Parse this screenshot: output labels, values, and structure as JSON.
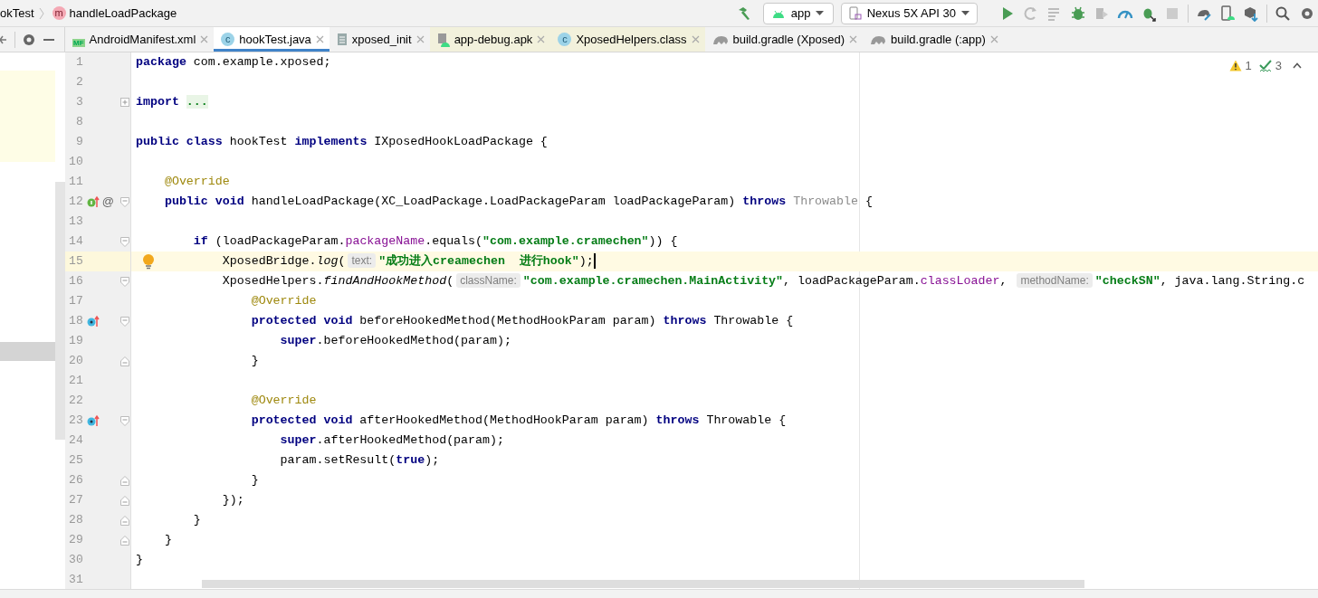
{
  "breadcrumb": [
    {
      "text": "okTest"
    },
    {
      "text": "handleLoadPackage",
      "icon_letter": "m"
    }
  ],
  "toolbar": {
    "run_config": "app",
    "device": "Nexus 5X API 30"
  },
  "tabs": [
    {
      "label": "AndroidManifest.xml",
      "kind": "manifest",
      "icon_text": "MF",
      "selected": false,
      "external": false
    },
    {
      "label": "hookTest.java",
      "kind": "java",
      "icon_text": "c",
      "selected": true,
      "external": false
    },
    {
      "label": "xposed_init",
      "kind": "text",
      "selected": false,
      "external": false
    },
    {
      "label": "app-debug.apk",
      "kind": "apk",
      "selected": false,
      "external": true
    },
    {
      "label": "XposedHelpers.class",
      "kind": "class",
      "icon_text": "c",
      "selected": false,
      "external": true
    },
    {
      "label": "build.gradle (Xposed)",
      "kind": "gradle",
      "selected": false,
      "external": false
    },
    {
      "label": "build.gradle (:app)",
      "kind": "gradle",
      "selected": false,
      "external": false
    }
  ],
  "inspections": {
    "warnings": "1",
    "typos": "3"
  },
  "lines": [
    {
      "number": "1",
      "current": false,
      "tokens": [
        {
          "kind": "k",
          "text": "package"
        },
        {
          "kind": "p",
          "text": " com.example.xposed;"
        }
      ]
    },
    {
      "number": "2",
      "current": false
    },
    {
      "number": "3",
      "current": false,
      "folded": true,
      "tokens": [
        {
          "kind": "k",
          "text": "import "
        },
        {
          "kind": "fold",
          "text": "..."
        }
      ]
    },
    {
      "number": "8",
      "current": false
    },
    {
      "number": "9",
      "current": false,
      "tokens": [
        {
          "kind": "k",
          "text": "public class"
        },
        {
          "kind": "p",
          "text": " hookTest "
        },
        {
          "kind": "k",
          "text": "implements"
        },
        {
          "kind": "p",
          "text": " IXposedHookLoadPackage {"
        }
      ]
    },
    {
      "number": "10",
      "current": false
    },
    {
      "number": "11",
      "current": false,
      "tokens": [
        {
          "kind": "a",
          "text": "    @Override"
        }
      ]
    },
    {
      "number": "12",
      "current": false,
      "implements": true,
      "marker_text": "@",
      "fold_start": true,
      "tokens": [
        {
          "kind": "k",
          "text": "    public void"
        },
        {
          "kind": "p",
          "text": " handleLoadPackage(XC_LoadPackage.LoadPackageParam loadPackageParam) "
        },
        {
          "kind": "k",
          "text": "throws"
        },
        {
          "kind": "g",
          "text": " Throwable"
        },
        {
          "kind": "p",
          "text": " {"
        }
      ]
    },
    {
      "number": "13",
      "current": false
    },
    {
      "number": "14",
      "current": false,
      "fold_start": true,
      "tokens": [
        {
          "kind": "k",
          "text": "        if"
        },
        {
          "kind": "p",
          "text": " (loadPackageParam."
        },
        {
          "kind": "f",
          "text": "packageName"
        },
        {
          "kind": "p",
          "text": ".equals("
        },
        {
          "kind": "s",
          "text": "\"com.example.cramechen\""
        },
        {
          "kind": "p",
          "text": ")) {"
        }
      ]
    },
    {
      "number": "15",
      "current": true,
      "bulb": true,
      "caret": true,
      "tokens": [
        {
          "kind": "p",
          "text": "            XposedBridge."
        },
        {
          "kind": "i",
          "text": "log"
        },
        {
          "kind": "p",
          "text": "("
        },
        {
          "kind": "h",
          "text": "text:"
        },
        {
          "kind": "s",
          "text": "\"成功进入creamechen  进行hook\""
        },
        {
          "kind": "p",
          "text": ");"
        }
      ]
    },
    {
      "number": "16",
      "current": false,
      "fold_start": true,
      "tokens": [
        {
          "kind": "p",
          "text": "            XposedHelpers."
        },
        {
          "kind": "i",
          "text": "findAndHookMethod"
        },
        {
          "kind": "p",
          "text": "("
        },
        {
          "kind": "h",
          "text": "className:"
        },
        {
          "kind": "s",
          "text": "\"com.example.cramechen.MainActivity\""
        },
        {
          "kind": "p",
          "text": ", loadPackageParam."
        },
        {
          "kind": "f",
          "text": "classLoader"
        },
        {
          "kind": "p",
          "text": ", "
        },
        {
          "kind": "h",
          "text": "methodName:"
        },
        {
          "kind": "s",
          "text": "\"checkSN\""
        },
        {
          "kind": "p",
          "text": ", java.lang.String.c"
        }
      ]
    },
    {
      "number": "17",
      "current": false,
      "tokens": [
        {
          "kind": "a",
          "text": "                @Override"
        }
      ]
    },
    {
      "number": "18",
      "current": false,
      "overrides": true,
      "fold_start": true,
      "tokens": [
        {
          "kind": "k",
          "text": "                protected void"
        },
        {
          "kind": "p",
          "text": " beforeHookedMethod(MethodHookParam param) "
        },
        {
          "kind": "k",
          "text": "throws"
        },
        {
          "kind": "p",
          "text": " Throwable {"
        }
      ]
    },
    {
      "number": "19",
      "current": false,
      "tokens": [
        {
          "kind": "k",
          "text": "                    super"
        },
        {
          "kind": "p",
          "text": ".beforeHookedMethod(param);"
        }
      ]
    },
    {
      "number": "20",
      "current": false,
      "fold_end": true,
      "tokens": [
        {
          "kind": "p",
          "text": "                }"
        }
      ]
    },
    {
      "number": "21",
      "current": false
    },
    {
      "number": "22",
      "current": false,
      "tokens": [
        {
          "kind": "a",
          "text": "                @Override"
        }
      ]
    },
    {
      "number": "23",
      "current": false,
      "overrides": true,
      "fold_start": true,
      "tokens": [
        {
          "kind": "k",
          "text": "                protected void"
        },
        {
          "kind": "p",
          "text": " afterHookedMethod(MethodHookParam param) "
        },
        {
          "kind": "k",
          "text": "throws"
        },
        {
          "kind": "p",
          "text": " Throwable {"
        }
      ]
    },
    {
      "number": "24",
      "current": false,
      "tokens": [
        {
          "kind": "k",
          "text": "                    super"
        },
        {
          "kind": "p",
          "text": ".afterHookedMethod(param);"
        }
      ]
    },
    {
      "number": "25",
      "current": false,
      "tokens": [
        {
          "kind": "p",
          "text": "                    param.setResult("
        },
        {
          "kind": "k",
          "text": "true"
        },
        {
          "kind": "p",
          "text": ");"
        }
      ]
    },
    {
      "number": "26",
      "current": false,
      "fold_end": true,
      "tokens": [
        {
          "kind": "p",
          "text": "                }"
        }
      ]
    },
    {
      "number": "27",
      "current": false,
      "fold_end": true,
      "tokens": [
        {
          "kind": "p",
          "text": "            });"
        }
      ]
    },
    {
      "number": "28",
      "current": false,
      "fold_end": true,
      "tokens": [
        {
          "kind": "p",
          "text": "        }"
        }
      ]
    },
    {
      "number": "29",
      "current": false,
      "fold_end": true,
      "tokens": [
        {
          "kind": "p",
          "text": "    }"
        }
      ]
    },
    {
      "number": "30",
      "current": false,
      "tokens": [
        {
          "kind": "p",
          "text": "}"
        }
      ]
    },
    {
      "number": "31",
      "current": false
    }
  ]
}
